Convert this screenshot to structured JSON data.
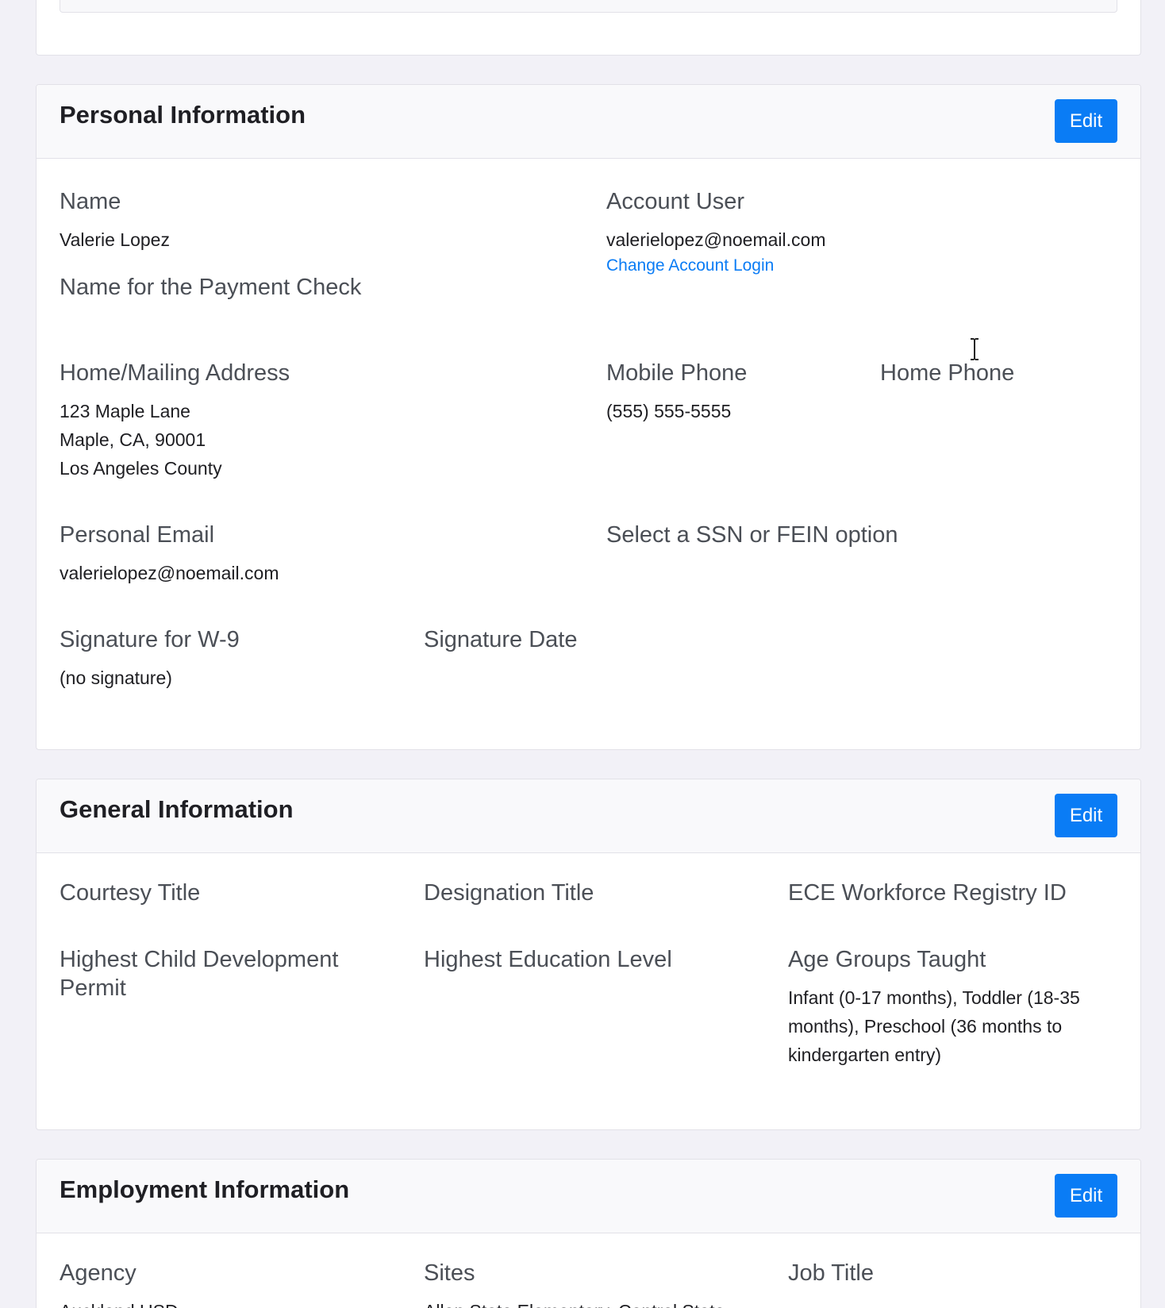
{
  "personal": {
    "title": "Personal Information",
    "edit_label": "Edit",
    "name_label": "Name",
    "name_value": "Valerie Lopez",
    "payment_check_label": "Name for the Payment Check",
    "account_user_label": "Account User",
    "account_user_value": "valerielopez@noemail.com",
    "change_login_link": "Change Account Login",
    "address_label": "Home/Mailing Address",
    "address_line1": "123 Maple Lane",
    "address_line2": "Maple, CA, 90001",
    "address_line3": "Los Angeles County",
    "mobile_phone_label": "Mobile Phone",
    "mobile_phone_value": "(555) 555-5555",
    "home_phone_label": "Home Phone",
    "personal_email_label": "Personal Email",
    "personal_email_value": "valerielopez@noemail.com",
    "ssn_fein_label": "Select a SSN or FEIN option",
    "signature_label": "Signature for W-9",
    "signature_value": "(no signature)",
    "signature_date_label": "Signature Date"
  },
  "general": {
    "title": "General Information",
    "edit_label": "Edit",
    "courtesy_title_label": "Courtesy Title",
    "designation_title_label": "Designation Title",
    "registry_id_label": "ECE Workforce Registry ID",
    "permit_label": "Highest Child Development Permit",
    "education_label": "Highest Education Level",
    "age_groups_label": "Age Groups Taught",
    "age_groups_value": "Infant (0-17 months), Toddler (18-35 months), Preschool (36 months to kindergarten entry)"
  },
  "employment": {
    "title": "Employment Information",
    "edit_label": "Edit",
    "agency_label": "Agency",
    "agency_value": "Auckland USD",
    "sites_label": "Sites",
    "sites_value": "Allen State Elementary, Central State",
    "job_title_label": "Job Title"
  }
}
